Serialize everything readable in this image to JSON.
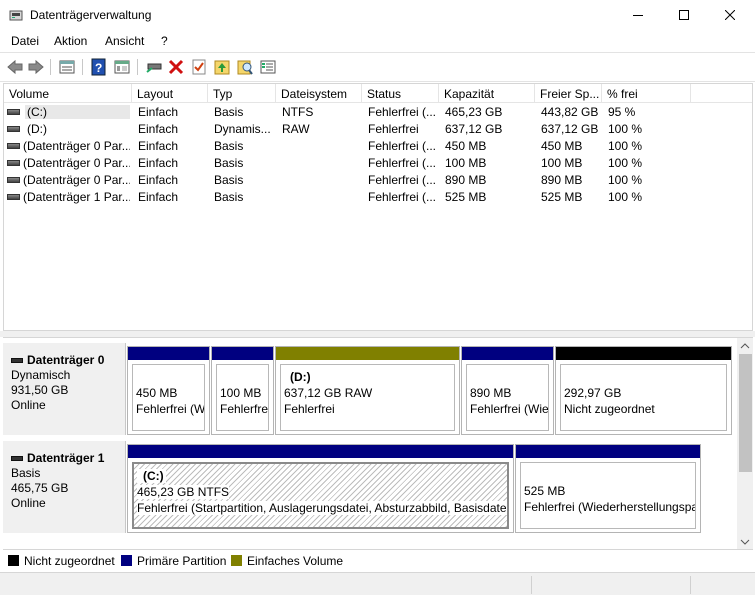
{
  "window": {
    "title": "Datenträgerverwaltung"
  },
  "menu": {
    "file": "Datei",
    "action": "Aktion",
    "view": "Ansicht",
    "help": "?"
  },
  "toolbar": {
    "icons": [
      "back-arrow-icon",
      "forward-arrow-icon",
      "list-view-icon",
      "help-icon",
      "properties-icon",
      "connect-drive-icon",
      "delete-icon",
      "check-icon",
      "upload-icon",
      "search-volume-icon",
      "settings-list-icon"
    ]
  },
  "table": {
    "columns": [
      "Volume",
      "Layout",
      "Typ",
      "Dateisystem",
      "Status",
      "Kapazität",
      "Freier Sp...",
      "% frei"
    ],
    "rows": [
      {
        "volume": "(C:)",
        "layout": "Einfach",
        "typ": "Basis",
        "fs": "NTFS",
        "status": "Fehlerfrei (...",
        "cap": "465,23 GB",
        "free": "443,82 GB",
        "pct": "95 %"
      },
      {
        "volume": "(D:)",
        "layout": "Einfach",
        "typ": "Dynamis...",
        "fs": "RAW",
        "status": "Fehlerfrei",
        "cap": "637,12 GB",
        "free": "637,12 GB",
        "pct": "100 %"
      },
      {
        "volume": "(Datenträger 0 Par...",
        "layout": "Einfach",
        "typ": "Basis",
        "fs": "",
        "status": "Fehlerfrei (...",
        "cap": "450 MB",
        "free": "450 MB",
        "pct": "100 %"
      },
      {
        "volume": "(Datenträger 0 Par...",
        "layout": "Einfach",
        "typ": "Basis",
        "fs": "",
        "status": "Fehlerfrei (...",
        "cap": "100 MB",
        "free": "100 MB",
        "pct": "100 %"
      },
      {
        "volume": "(Datenträger 0 Par...",
        "layout": "Einfach",
        "typ": "Basis",
        "fs": "",
        "status": "Fehlerfrei (...",
        "cap": "890 MB",
        "free": "890 MB",
        "pct": "100 %"
      },
      {
        "volume": "(Datenträger 1 Par...",
        "layout": "Einfach",
        "typ": "Basis",
        "fs": "",
        "status": "Fehlerfrei (...",
        "cap": "525 MB",
        "free": "525 MB",
        "pct": "100 %"
      }
    ]
  },
  "disks": [
    {
      "name": "Datenträger 0",
      "type": "Dynamisch",
      "size": "931,50 GB",
      "state": "Online",
      "partitions": [
        {
          "title": "",
          "line1": "450 MB",
          "line2": "Fehlerfrei (W",
          "color": "#000080"
        },
        {
          "title": "",
          "line1": "100 MB",
          "line2": "Fehlerfrei",
          "color": "#000080"
        },
        {
          "title": "(D:)",
          "line1": "637,12 GB RAW",
          "line2": "Fehlerfrei",
          "color": "#808000"
        },
        {
          "title": "",
          "line1": "890 MB",
          "line2": "Fehlerfrei (Wie",
          "color": "#000080"
        },
        {
          "title": "",
          "line1": "292,97 GB",
          "line2": "Nicht zugeordnet",
          "color": "#000000"
        }
      ]
    },
    {
      "name": "Datenträger 1",
      "type": "Basis",
      "size": "465,75 GB",
      "state": "Online",
      "partitions": [
        {
          "title": "(C:)",
          "line1": "465,23 GB NTFS",
          "line2": "Fehlerfrei (Startpartition, Auslagerungsdatei, Absturzabbild, Basisdatenp",
          "color": "#000080"
        },
        {
          "title": "",
          "line1": "525 MB",
          "line2": "Fehlerfrei (Wiederherstellungspa",
          "color": "#000080"
        }
      ]
    }
  ],
  "legend": [
    {
      "label": "Nicht zugeordnet",
      "color": "#000000"
    },
    {
      "label": "Primäre Partition",
      "color": "#000080"
    },
    {
      "label": "Einfaches Volume",
      "color": "#808000"
    }
  ]
}
